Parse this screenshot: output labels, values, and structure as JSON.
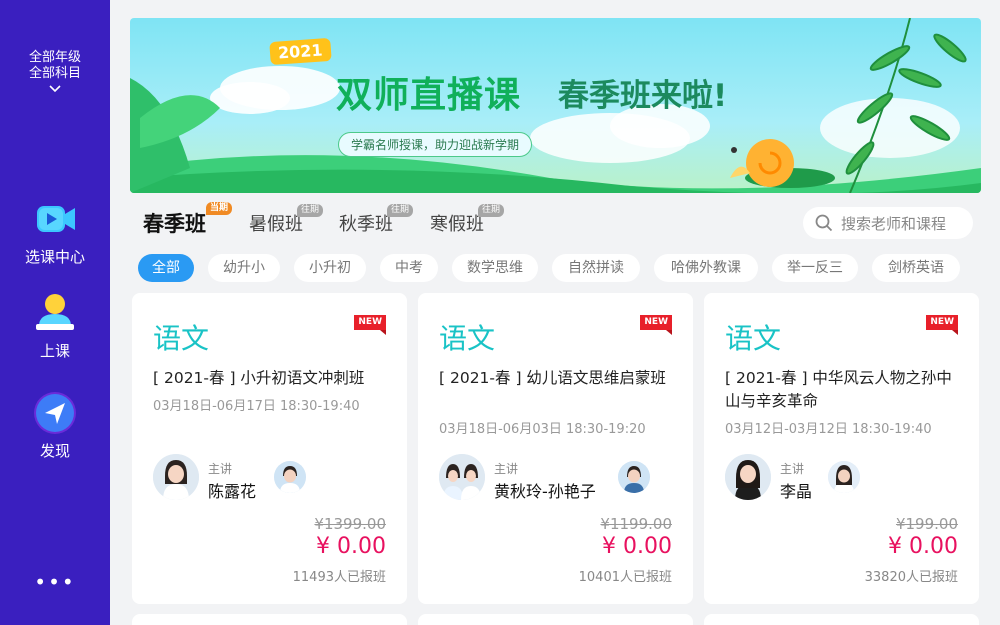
{
  "sidebar": {
    "grade_filter_line1": "全部年级",
    "grade_filter_line2": "全部科目",
    "nav": [
      {
        "label": "选课中心",
        "icon": "video-camera-icon"
      },
      {
        "label": "上课",
        "icon": "teacher-desk-icon"
      },
      {
        "label": "发现",
        "icon": "compass-arrow-icon"
      }
    ],
    "more": "•••"
  },
  "banner": {
    "year": "2021",
    "title": "双师直播课",
    "title2": "春季班来啦!",
    "subtitle": "学霸名师授课，助力迎战新学期"
  },
  "season_tabs": [
    {
      "label": "春季班",
      "badge": "当期",
      "active": true
    },
    {
      "label": "暑假班",
      "badge": "往期"
    },
    {
      "label": "秋季班",
      "badge": "往期"
    },
    {
      "label": "寒假班",
      "badge": "往期"
    }
  ],
  "search": {
    "placeholder": "搜索老师和课程"
  },
  "categories": [
    "全部",
    "幼升小",
    "小升初",
    "中考",
    "数学思维",
    "自然拼读",
    "哈佛外教课",
    "举一反三",
    "剑桥英语"
  ],
  "cards": [
    {
      "subject": "语文",
      "badge": "NEW",
      "title": "[ 2021-春 ] 小升初语文冲刺班",
      "time": "03月18日-06月17日 18:30-19:40",
      "role": "主讲",
      "teacher": "陈露花",
      "orig_price": "¥1399.00",
      "price": "¥ 0.00",
      "enrolled": "11493人已报班"
    },
    {
      "subject": "语文",
      "badge": "NEW",
      "title": "[ 2021-春 ] 幼儿语文思维启蒙班",
      "time": "03月18日-06月03日 18:30-19:20",
      "role": "主讲",
      "teacher": "黄秋玲-孙艳子",
      "orig_price": "¥1199.00",
      "price": "¥ 0.00",
      "enrolled": "10401人已报班"
    },
    {
      "subject": "语文",
      "badge": "NEW",
      "title": "[ 2021-春 ] 中华风云人物之孙中山与辛亥革命",
      "time": "03月12日-03月12日 18:30-19:40",
      "role": "主讲",
      "teacher": "李晶",
      "orig_price": "¥199.00",
      "price": "¥ 0.00",
      "enrolled": "33820人已报班"
    }
  ]
}
